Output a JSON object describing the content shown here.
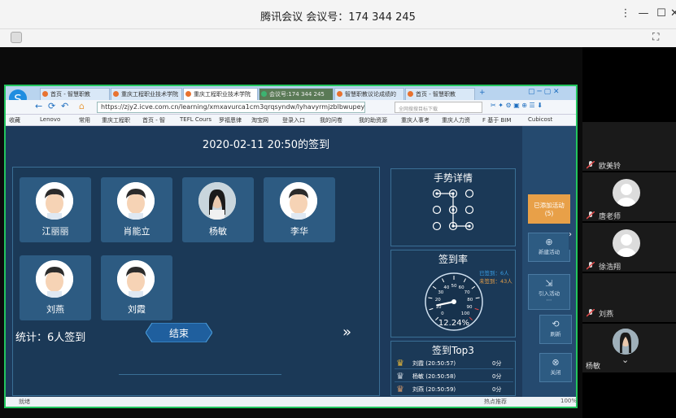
{
  "meeting": {
    "title": "腾讯会议 会议号：174 344 245"
  },
  "browser": {
    "tabs": [
      "首页 - 智慧职教",
      "重庆工程职业技术学院",
      "重庆工程职业技术学院",
      "会议号:174 344 245",
      "智慧职教议论成绩的",
      "首页 - 智慧职教"
    ],
    "url": "https://zjy2.icve.com.cn/learning/xmxavurca1cm3qrqsyndw/lyhavyrmjzblbwupeybg/co",
    "search_placeholder": "全网搜搜目标下载",
    "favorites": [
      "收藏",
      "Lenovo",
      "常用",
      "重庆工程职",
      "首页 - 智",
      "TEFL Cours",
      "罗福恩律",
      "淘宝网",
      "登录入口",
      "我的问卷",
      "我的助资源",
      "重庆人事考",
      "重庆人力资",
      "F 基于 BIM",
      "Cubicost"
    ],
    "status_left": "就绪",
    "status_right": "热点推荐",
    "zoom": "100%"
  },
  "signin": {
    "date_title": "2020-02-11 20:50的签到",
    "students": [
      {
        "name": "江丽丽",
        "avatar": "cartoon"
      },
      {
        "name": "肖能立",
        "avatar": "cartoon"
      },
      {
        "name": "杨敏",
        "avatar": "photo"
      },
      {
        "name": "李华",
        "avatar": "cartoon"
      },
      {
        "name": "刘燕",
        "avatar": "cartoon"
      },
      {
        "name": "刘霞",
        "avatar": "cartoon"
      }
    ],
    "stats": "统计：6人签到",
    "end_button": "结束",
    "gesture_title": "手势详情",
    "rate_title": "签到率",
    "signed_label": "已签到：6人",
    "unsigned_label": "未签到：43人",
    "rate_value": "12.24%",
    "rate_percent": 12.24,
    "gauge_ticks": [
      "0",
      "10",
      "20",
      "30",
      "40",
      "50",
      "60",
      "70",
      "80",
      "90",
      "100"
    ],
    "top3_title": "签到Top3",
    "top3": [
      {
        "name": "刘霞 (20:50:57)",
        "score": "0分"
      },
      {
        "name": "杨敏 (20:50:58)",
        "score": "0分"
      },
      {
        "name": "刘燕 (20:50:59)",
        "score": "0分"
      }
    ]
  },
  "sidebar": {
    "added": "已添加活动",
    "added_count": "(5)",
    "new_activity": "新建活动",
    "import_activity": "引入活动",
    "refresh": "刷新",
    "close": "关闭"
  },
  "participants": [
    {
      "name": "欧美铃"
    },
    {
      "name": "唐老师"
    },
    {
      "name": "徐浩翔"
    },
    {
      "name": "刘燕"
    },
    {
      "name": "杨敏"
    }
  ],
  "colors": {
    "accent": "#e8a048",
    "panel": "#1d3a5b",
    "share_border": "#22c55e"
  }
}
